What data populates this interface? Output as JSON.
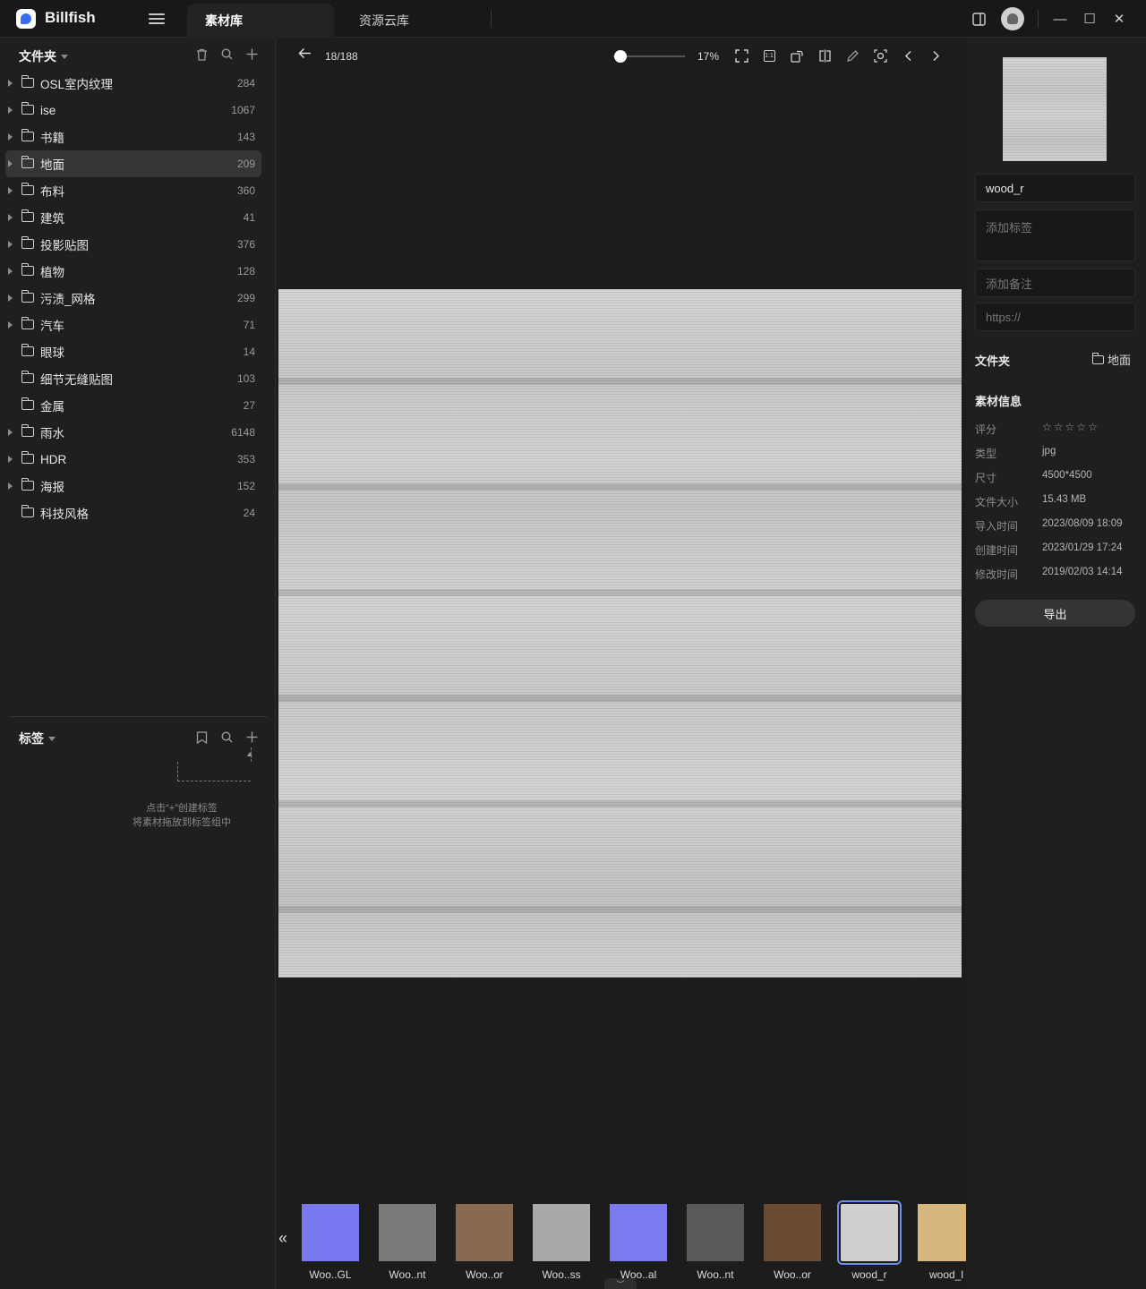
{
  "app": {
    "name": "Billfish"
  },
  "tabs": [
    {
      "label": "素材库",
      "active": true
    },
    {
      "label": "资源云库",
      "active": false
    }
  ],
  "window_controls": {
    "minimize": "—",
    "maximize": "☐",
    "close": "✕"
  },
  "sidebar": {
    "folders_title": "文件夹",
    "folders": [
      {
        "name": "OSL室内纹理",
        "count": "284",
        "has_children": true,
        "selected": false
      },
      {
        "name": "ise",
        "count": "1067",
        "has_children": true,
        "selected": false
      },
      {
        "name": "书籍",
        "count": "143",
        "has_children": true,
        "selected": false
      },
      {
        "name": "地面",
        "count": "209",
        "has_children": true,
        "selected": true
      },
      {
        "name": "布料",
        "count": "360",
        "has_children": true,
        "selected": false
      },
      {
        "name": "建筑",
        "count": "41",
        "has_children": true,
        "selected": false
      },
      {
        "name": "投影贴图",
        "count": "376",
        "has_children": true,
        "selected": false
      },
      {
        "name": "植物",
        "count": "128",
        "has_children": true,
        "selected": false
      },
      {
        "name": "污渍_网格",
        "count": "299",
        "has_children": true,
        "selected": false
      },
      {
        "name": "汽车",
        "count": "71",
        "has_children": true,
        "selected": false
      },
      {
        "name": "眼球",
        "count": "14",
        "has_children": false,
        "selected": false
      },
      {
        "name": "细节无缝贴图",
        "count": "103",
        "has_children": false,
        "selected": false
      },
      {
        "name": "金属",
        "count": "27",
        "has_children": false,
        "selected": false
      },
      {
        "name": "雨水",
        "count": "6148",
        "has_children": true,
        "selected": false
      },
      {
        "name": "HDR",
        "count": "353",
        "has_children": true,
        "selected": false
      },
      {
        "name": "海报",
        "count": "152",
        "has_children": true,
        "selected": false
      },
      {
        "name": "科技风格",
        "count": "24",
        "has_children": false,
        "selected": false
      }
    ],
    "tags_title": "标签",
    "tags_hint_line1": "点击“+”创建标签",
    "tags_hint_line2": "将素材拖放到标签组中"
  },
  "viewer": {
    "pager": "18/188",
    "zoom": "17%",
    "zoom_fraction": 0.1,
    "thumbnails": [
      {
        "label": "Woo..GL",
        "color": "#7b79f2",
        "active": false
      },
      {
        "label": "Woo..nt",
        "color": "#7a7a7a",
        "active": false
      },
      {
        "label": "Woo..or",
        "color": "#8a6a4f",
        "active": false
      },
      {
        "label": "Woo..ss",
        "color": "#a9a9a9",
        "active": false
      },
      {
        "label": "Woo..al",
        "color": "#7c7af0",
        "active": false
      },
      {
        "label": "Woo..nt",
        "color": "#5a5a5a",
        "active": false
      },
      {
        "label": "Woo..or",
        "color": "#6b4a33",
        "active": false
      },
      {
        "label": "wood_r",
        "color": "#cfcfcf",
        "active": true
      },
      {
        "label": "wood_l",
        "color": "#d8b77f",
        "active": false
      }
    ]
  },
  "details": {
    "name": "wood_r",
    "tags_placeholder": "添加标签",
    "note_placeholder": "添加备注",
    "url_placeholder": "https://",
    "folder_label": "文件夹",
    "folder_value": "地面",
    "info_title": "素材信息",
    "info": [
      {
        "label": "评分",
        "value": ""
      },
      {
        "label": "类型",
        "value": "jpg"
      },
      {
        "label": "尺寸",
        "value": "4500*4500"
      },
      {
        "label": "文件大小",
        "value": "15.43 MB"
      },
      {
        "label": "导入时间",
        "value": "2023/08/09 18:09"
      },
      {
        "label": "创建时间",
        "value": "2023/01/29 17:24"
      },
      {
        "label": "修改时间",
        "value": "2019/02/03 14:14"
      }
    ],
    "rating": 0,
    "export_label": "导出"
  }
}
